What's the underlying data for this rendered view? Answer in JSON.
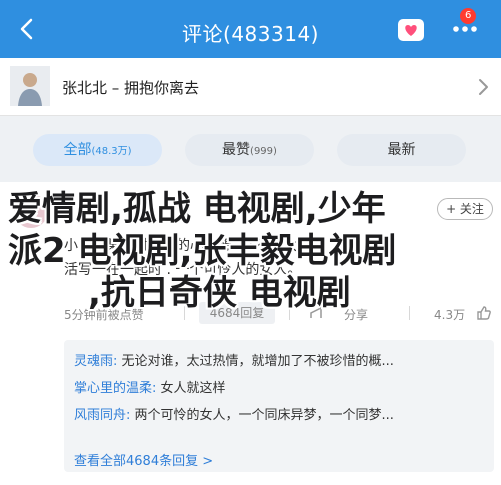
{
  "header": {
    "title": "评论(483314)",
    "notification_count": "6"
  },
  "song": {
    "title": "张北北 – 拥抱你离去"
  },
  "tabs": [
    {
      "label": "全部",
      "count": "(48.3万)"
    },
    {
      "label": "最赞",
      "count": "(999)"
    },
    {
      "label": "最新",
      "count": ""
    }
  ],
  "comment": {
    "follow_label": "+ 关注",
    "body_line1": "小目，某那时候我的心里想 .又不为太多的",
    "body_line2": "活写一在一起时 . 一个可怜人的女人。",
    "time": "5分钟前被点赞",
    "reply_count": "4684回复",
    "share_label": "分享",
    "likes": "4.3万"
  },
  "replies": [
    {
      "name": "灵魂雨:",
      "text": "无论对谁，太过热情，就增加了不被珍惜的概..."
    },
    {
      "name": "掌心里的温柔:",
      "text": "女人就这样"
    },
    {
      "name": "风雨同舟:",
      "text": "两个可怜的女人，一个同床异梦，一个同梦..."
    }
  ],
  "replies_more": "查看全部4684条回复 >",
  "overlay": {
    "line1": "爱情剧,孤战 电视剧,少年",
    "line2": "派2 电视剧,张丰毅电视剧",
    "line3": ",抗日奇侠 电视剧"
  }
}
